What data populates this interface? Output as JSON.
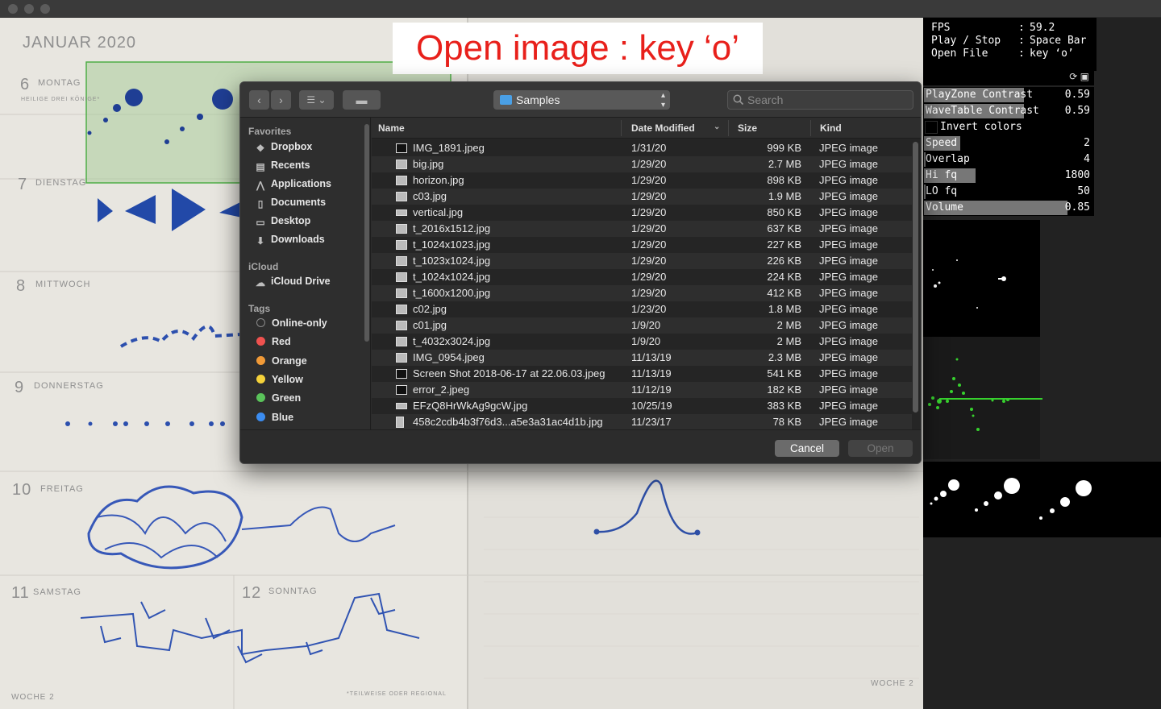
{
  "caption": "Open image : key ‘o’",
  "notebook": {
    "month": "JANUAR 2020",
    "days": [
      {
        "num": "6",
        "name": "MONTAG"
      },
      {
        "num": "7",
        "name": "DIENSTAG"
      },
      {
        "num": "8",
        "name": "MITTWOCH"
      },
      {
        "num": "9",
        "name": "DONNERSTAG"
      },
      {
        "num": "10",
        "name": "FREITAG"
      },
      {
        "num": "11",
        "name": "SAMSTAG"
      },
      {
        "num": "12",
        "name": "SONNTAG"
      }
    ],
    "holiday": "HEILIGE DREI KÖNIGE*",
    "week_left": "WOCHE 2",
    "week_right": "WOCHE 2",
    "footnote": "*TEILWEISE ODER REGIONAL"
  },
  "stats": [
    {
      "key": "FPS",
      "value": "59.2"
    },
    {
      "key": "Play / Stop",
      "value": "Space Bar"
    },
    {
      "key": "Open File",
      "value": "key ‘o’"
    }
  ],
  "controls_icons": "⟳ ▣",
  "controls": [
    {
      "label": "PlayZone Contrast",
      "value": "0.59",
      "fill": 0.59
    },
    {
      "label": "WaveTable Contrast",
      "value": "0.59",
      "fill": 0.59
    },
    {
      "label": "Invert colors",
      "value": "",
      "checkbox": true
    },
    {
      "label": "Speed",
      "value": "2",
      "fill": 0.13
    },
    {
      "label": "Overlap",
      "value": "4",
      "fill": 0.04
    },
    {
      "label": "Hi fq",
      "value": "1800",
      "fill": 0.31
    },
    {
      "label": "LO fq",
      "value": "50",
      "fill": 0.05
    },
    {
      "label": "Volume",
      "value": "0.85",
      "fill": 0.85
    }
  ],
  "dialog": {
    "location": "Samples",
    "search_placeholder": "Search",
    "sidebar": {
      "favorites_title": "Favorites",
      "favorites": [
        {
          "label": "Dropbox",
          "icon": "dropbox-icon"
        },
        {
          "label": "Recents",
          "icon": "recents-icon"
        },
        {
          "label": "Applications",
          "icon": "applications-icon"
        },
        {
          "label": "Documents",
          "icon": "documents-icon"
        },
        {
          "label": "Desktop",
          "icon": "desktop-icon"
        },
        {
          "label": "Downloads",
          "icon": "downloads-icon"
        }
      ],
      "icloud_title": "iCloud",
      "icloud": [
        {
          "label": "iCloud Drive",
          "icon": "cloud-icon"
        }
      ],
      "tags_title": "Tags",
      "tags": [
        {
          "label": "Online-only",
          "color": "#2e2e2e"
        },
        {
          "label": "Red",
          "color": "#f0524f"
        },
        {
          "label": "Orange",
          "color": "#f19a37"
        },
        {
          "label": "Yellow",
          "color": "#f5d23a"
        },
        {
          "label": "Green",
          "color": "#5ac35a"
        },
        {
          "label": "Blue",
          "color": "#3b8cf0"
        }
      ]
    },
    "columns": {
      "name": "Name",
      "date": "Date Modified",
      "size": "Size",
      "kind": "Kind"
    },
    "files": [
      {
        "name": "IMG_1891.jpeg",
        "date": "1/31/20",
        "size": "999 KB",
        "kind": "JPEG image"
      },
      {
        "name": "big.jpg",
        "date": "1/29/20",
        "size": "2.7 MB",
        "kind": "JPEG image"
      },
      {
        "name": "horizon.jpg",
        "date": "1/29/20",
        "size": "898 KB",
        "kind": "JPEG image"
      },
      {
        "name": "c03.jpg",
        "date": "1/29/20",
        "size": "1.9 MB",
        "kind": "JPEG image"
      },
      {
        "name": "vertical.jpg",
        "date": "1/29/20",
        "size": "850 KB",
        "kind": "JPEG image"
      },
      {
        "name": "t_2016x1512.jpg",
        "date": "1/29/20",
        "size": "637 KB",
        "kind": "JPEG image"
      },
      {
        "name": "t_1024x1023.jpg",
        "date": "1/29/20",
        "size": "227 KB",
        "kind": "JPEG image"
      },
      {
        "name": "t_1023x1024.jpg",
        "date": "1/29/20",
        "size": "226 KB",
        "kind": "JPEG image"
      },
      {
        "name": "t_1024x1024.jpg",
        "date": "1/29/20",
        "size": "224 KB",
        "kind": "JPEG image"
      },
      {
        "name": "t_1600x1200.jpg",
        "date": "1/29/20",
        "size": "412 KB",
        "kind": "JPEG image"
      },
      {
        "name": "c02.jpg",
        "date": "1/23/20",
        "size": "1.8 MB",
        "kind": "JPEG image"
      },
      {
        "name": "c01.jpg",
        "date": "1/9/20",
        "size": "2 MB",
        "kind": "JPEG image"
      },
      {
        "name": "t_4032x3024.jpg",
        "date": "1/9/20",
        "size": "2 MB",
        "kind": "JPEG image"
      },
      {
        "name": "IMG_0954.jpeg",
        "date": "11/13/19",
        "size": "2.3 MB",
        "kind": "JPEG image"
      },
      {
        "name": "Screen Shot 2018-06-17 at 22.06.03.jpeg",
        "date": "11/13/19",
        "size": "541 KB",
        "kind": "JPEG image"
      },
      {
        "name": "error_2.jpeg",
        "date": "11/12/19",
        "size": "182 KB",
        "kind": "JPEG image"
      },
      {
        "name": "EFzQ8HrWkAg9gcW.jpg",
        "date": "10/25/19",
        "size": "383 KB",
        "kind": "JPEG image"
      },
      {
        "name": "458c2cdb4b3f76d3...a5e3a31ac4d1b.jpg",
        "date": "11/23/17",
        "size": "78 KB",
        "kind": "JPEG image"
      }
    ],
    "cancel_label": "Cancel",
    "open_label": "Open"
  }
}
